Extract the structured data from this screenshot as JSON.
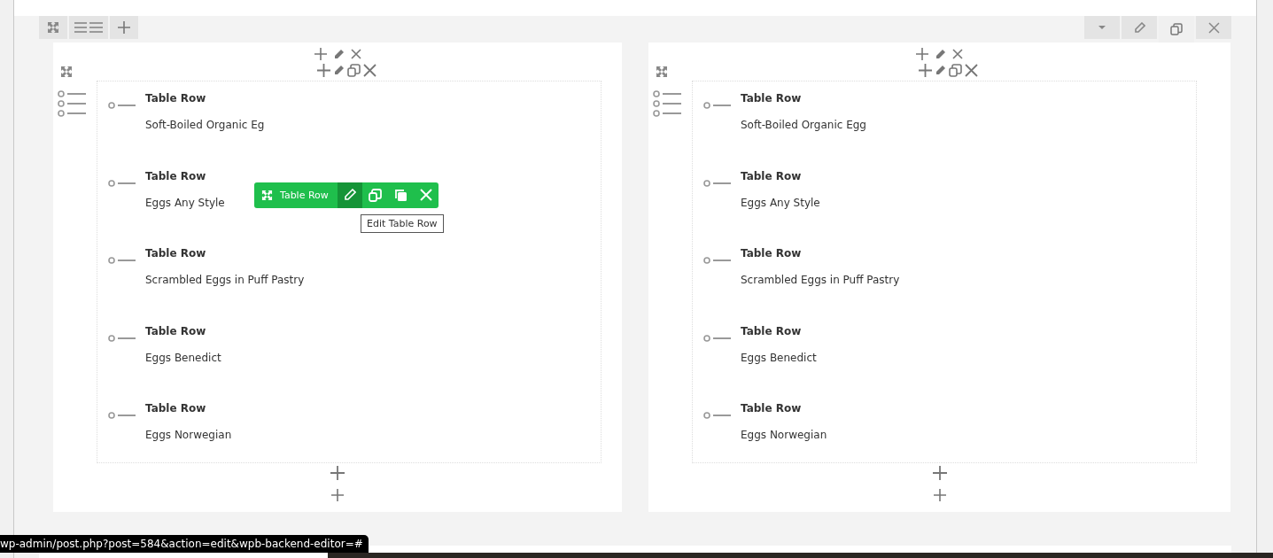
{
  "columns": [
    {
      "rows": [
        {
          "title": "Table Row",
          "text": "Soft-Boiled Organic Eg",
          "hovered": false
        },
        {
          "title": "Table Row",
          "text": "Eggs Any Style",
          "hovered": true
        },
        {
          "title": "Table Row",
          "text": "Scrambled Eggs in Puff Pastry",
          "hovered": false
        },
        {
          "title": "Table Row",
          "text": "Eggs Benedict",
          "hovered": false
        },
        {
          "title": "Table Row",
          "text": "Eggs Norwegian",
          "hovered": false
        }
      ]
    },
    {
      "rows": [
        {
          "title": "Table Row",
          "text": "Soft-Boiled Organic Egg",
          "hovered": false
        },
        {
          "title": "Table Row",
          "text": "Eggs Any Style",
          "hovered": false
        },
        {
          "title": "Table Row",
          "text": "Scrambled Eggs in Puff Pastry",
          "hovered": false
        },
        {
          "title": "Table Row",
          "text": "Eggs Benedict",
          "hovered": false
        },
        {
          "title": "Table Row",
          "text": "Eggs Norwegian",
          "hovered": false
        }
      ]
    }
  ],
  "element_toolbar": {
    "label": "Table Row",
    "tooltip": "Edit Table Row"
  },
  "status_url": "wp-admin/post.php?post=584&action=edit&wpb-backend-editor=#"
}
